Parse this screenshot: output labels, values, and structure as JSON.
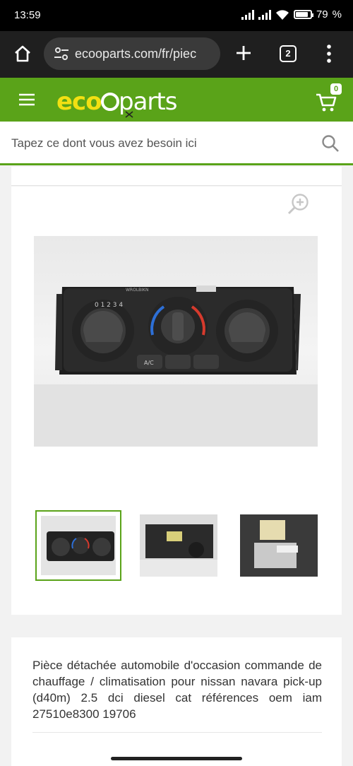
{
  "status": {
    "time": "13:59",
    "battery": "79"
  },
  "browser": {
    "url": "ecooparts.com/fr/piec",
    "tab_count": "2"
  },
  "site": {
    "cart_count": "0"
  },
  "search": {
    "placeholder": "Tapez ce dont vous avez besoin ici"
  },
  "product": {
    "description": "Pièce détachée automobile d'occasion commande de chauffage / climatisation pour nissan navara pick-up (d40m) 2.5 dci diesel cat références oem iam 27510e8300 19706",
    "panel_text": {
      "ac": "A/C",
      "model": "WROLBIKN",
      "digits": "0 1 2 3 4"
    }
  },
  "colors": {
    "brand_green": "#5aa319",
    "logo_yellow": "#f2e012"
  },
  "icons": [
    "home-icon",
    "tune-icon",
    "plus-icon",
    "tabs-icon",
    "more-vert-icon",
    "menu-icon",
    "cart-icon",
    "search-icon",
    "zoom-in-icon"
  ]
}
